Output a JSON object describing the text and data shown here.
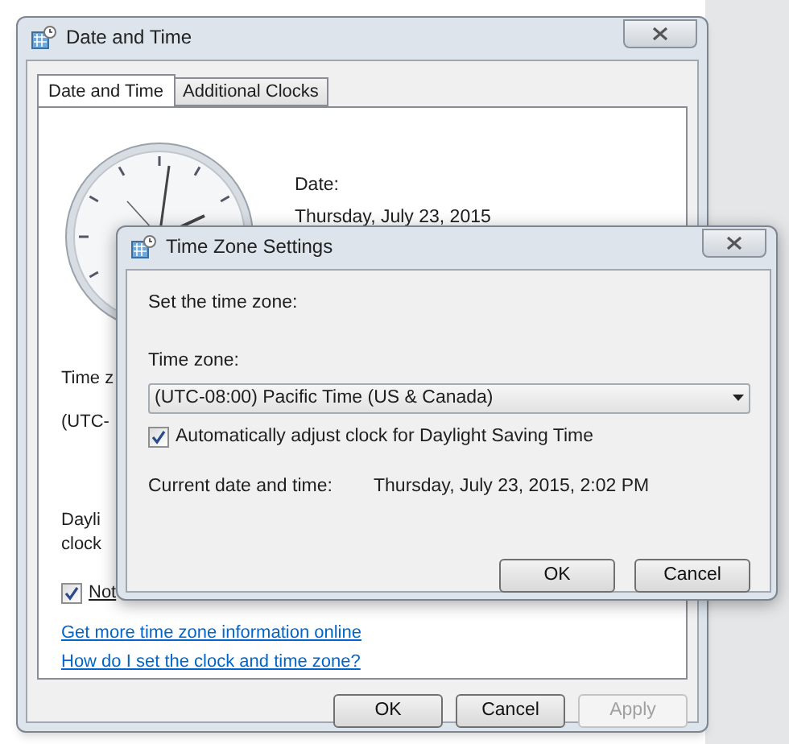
{
  "main_window": {
    "title": "Date and Time",
    "tabs": [
      {
        "label": "Date and Time",
        "selected": true
      },
      {
        "label": "Additional Clocks",
        "selected": false
      }
    ],
    "date_label": "Date:",
    "date_value": "Thursday, July 23, 2015",
    "time_zone_label": "Time z",
    "time_zone_value": "(UTC-",
    "daylight_lines": [
      "Dayli",
      "clock"
    ],
    "notify_checkbox": {
      "label": "Not",
      "checked": true
    },
    "links": [
      "Get more time zone information online",
      "How do I set the clock and time zone?"
    ],
    "buttons": [
      {
        "label": "OK",
        "disabled": false
      },
      {
        "label": "Cancel",
        "disabled": false
      },
      {
        "label": "Apply",
        "disabled": true
      }
    ]
  },
  "time_zone_dialog": {
    "title": "Time Zone Settings",
    "prompt": "Set the time zone:",
    "time_zone_label": "Time zone:",
    "time_zone_select": "(UTC-08:00) Pacific Time (US & Canada)",
    "dst_checkbox": {
      "label": "Automatically adjust clock for Daylight Saving Time",
      "checked": true
    },
    "current_label": "Current date and time:",
    "current_value": "Thursday, July 23, 2015, 2:02 PM",
    "buttons": [
      {
        "label": "OK",
        "disabled": false
      },
      {
        "label": "Cancel",
        "disabled": false
      }
    ]
  }
}
